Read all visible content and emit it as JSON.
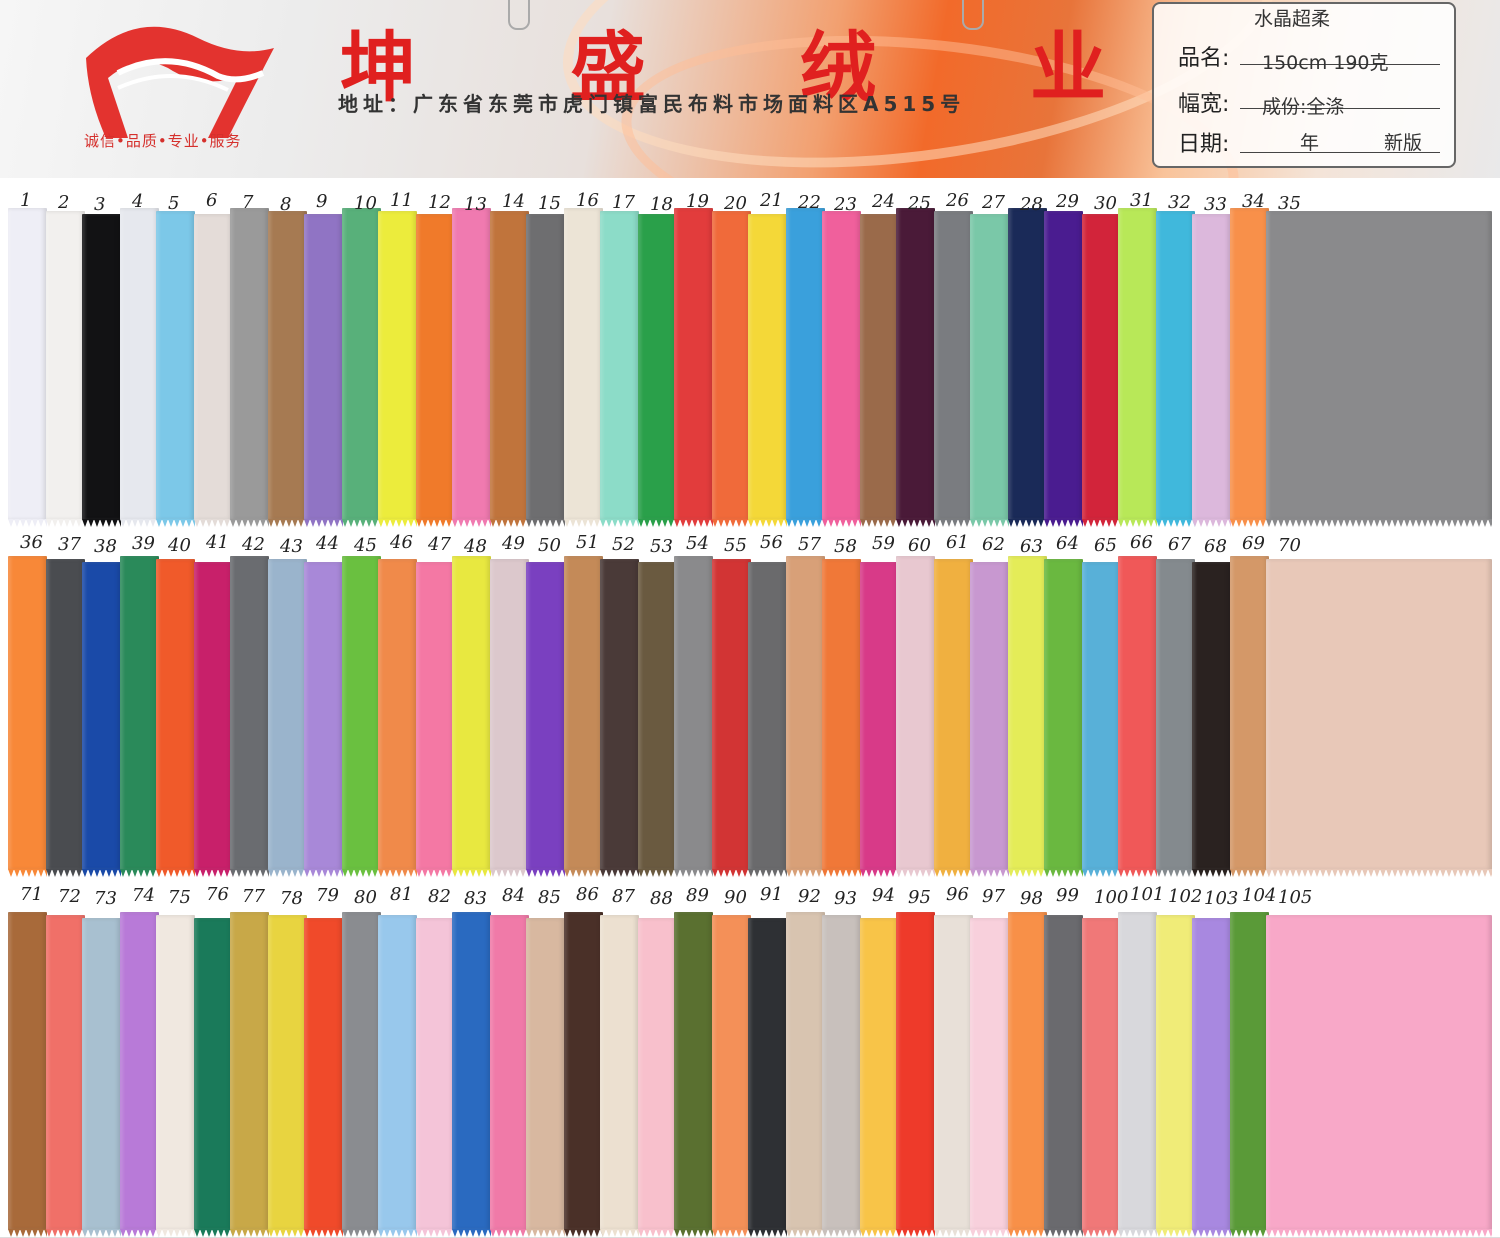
{
  "header": {
    "brand_chars": [
      "坤",
      "盛",
      "绒",
      "业"
    ],
    "slogan": "诚信•品质•专业•服务",
    "address": "地址：广东省东莞市虎门镇富民布料市场面料区A515号"
  },
  "infobox": {
    "product_value": "水晶超柔",
    "product_label": "品名:",
    "width_label": "幅宽:",
    "width_value": "150cm  190克",
    "composition_value": "成份:全涤",
    "date_label": "日期:",
    "date_year": "年",
    "date_edition": "新版"
  },
  "rows": [
    {
      "labels": [
        "1",
        "2",
        "3",
        "4",
        "5",
        "6",
        "7",
        "8",
        "9",
        "10",
        "11",
        "12",
        "13",
        "14",
        "15",
        "16",
        "17",
        "18",
        "19",
        "20",
        "21",
        "22",
        "23",
        "24",
        "25",
        "26",
        "27",
        "28",
        "29",
        "30",
        "31",
        "32",
        "33",
        "34",
        "35"
      ],
      "colors": [
        "#eeeef6",
        "#f2f0ee",
        "#121214",
        "#e6e8ee",
        "#7cc8e8",
        "#e4dcd8",
        "#9a9a9a",
        "#a67a52",
        "#9074c4",
        "#58b07a",
        "#ecec3c",
        "#f07a2a",
        "#f07ab0",
        "#c0743c",
        "#6e6e70",
        "#ece4d6",
        "#8cdcc8",
        "#2aa04a",
        "#e23c3c",
        "#f06a3a",
        "#f4d838",
        "#3aa0dc",
        "#f0609c",
        "#9a6a4a",
        "#4a1a38",
        "#7a7c80",
        "#7ac8a8",
        "#1a2a58",
        "#4a1c90",
        "#d2243a",
        "#b8e858",
        "#40b8dc",
        "#dcb8dc",
        "#f8904a",
        "#8a8a8c"
      ]
    },
    {
      "labels": [
        "36",
        "37",
        "38",
        "39",
        "40",
        "41",
        "42",
        "43",
        "44",
        "45",
        "46",
        "47",
        "48",
        "49",
        "50",
        "51",
        "52",
        "53",
        "54",
        "55",
        "56",
        "57",
        "58",
        "59",
        "60",
        "61",
        "62",
        "63",
        "64",
        "65",
        "66",
        "67",
        "68",
        "69",
        "70"
      ],
      "colors": [
        "#f88838",
        "#4a4c50",
        "#1a4aa8",
        "#2a8a5a",
        "#f05a2a",
        "#c8206a",
        "#6a6c70",
        "#9ab4cc",
        "#a888d8",
        "#6ac040",
        "#f08a4a",
        "#f478a4",
        "#e8e840",
        "#dcc8cc",
        "#7a40c0",
        "#c48a58",
        "#4a3a38",
        "#6a5a40",
        "#8a8a8c",
        "#d23434",
        "#6a6a6c",
        "#d8a078",
        "#f07838",
        "#d83a88",
        "#e8c8d0",
        "#f0b040",
        "#c898d0",
        "#e4ec58",
        "#6ab840",
        "#58b0d8",
        "#f05858",
        "#848a8e",
        "#2a2220",
        "#d49868",
        "#e8c8b8"
      ]
    },
    {
      "labels": [
        "71",
        "72",
        "73",
        "74",
        "75",
        "76",
        "77",
        "78",
        "79",
        "80",
        "81",
        "82",
        "83",
        "84",
        "85",
        "86",
        "87",
        "88",
        "89",
        "90",
        "91",
        "92",
        "93",
        "94",
        "95",
        "96",
        "97",
        "98",
        "99",
        "100",
        "101",
        "102",
        "103",
        "104",
        "105"
      ],
      "colors": [
        "#a86a3a",
        "#f07068",
        "#a8c0d0",
        "#b87ad8",
        "#f0e8e0",
        "#1a7a5a",
        "#c8a848",
        "#e8d440",
        "#f04a2a",
        "#8a8c90",
        "#98c8ec",
        "#f4c4d8",
        "#2a6ac0",
        "#f07aa8",
        "#d8b8a0",
        "#4a3028",
        "#ece0d0",
        "#f8c0cc",
        "#5a7030",
        "#f49058",
        "#2e3034",
        "#d8c4b0",
        "#c8c0bc",
        "#f8c448",
        "#ee3a2a",
        "#e8e0d8",
        "#f8d0dc",
        "#f89048",
        "#6a6a6e",
        "#f07878",
        "#d8d8dc",
        "#f0ec78",
        "#a888e0",
        "#5a9a38",
        "#f8a8c8"
      ]
    }
  ]
}
